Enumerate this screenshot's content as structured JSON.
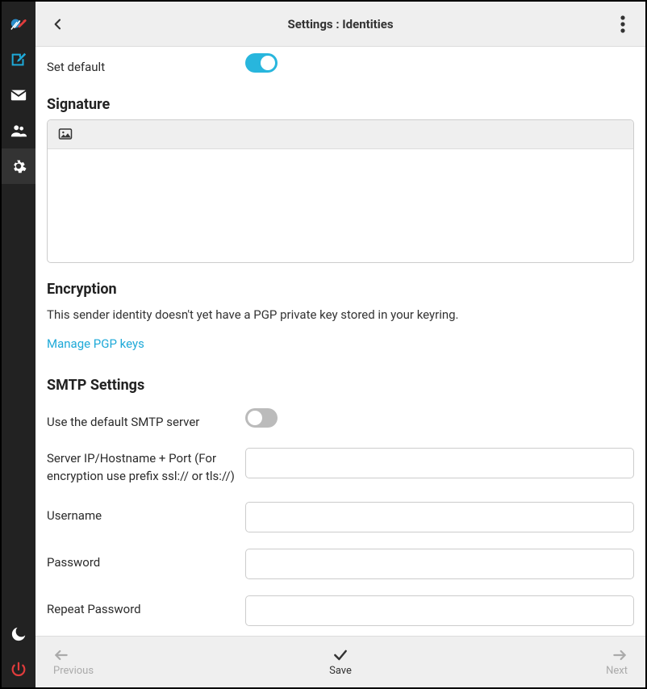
{
  "header": {
    "title": "Settings : Identities"
  },
  "set_default": {
    "label": "Set default",
    "on": true
  },
  "signature": {
    "title": "Signature"
  },
  "encryption": {
    "title": "Encryption",
    "message": "This sender identity doesn't yet have a PGP private key stored in your keyring.",
    "manage_link": "Manage PGP keys"
  },
  "smtp": {
    "title": "SMTP Settings",
    "use_default": {
      "label": "Use the default SMTP server",
      "on": false
    },
    "server": {
      "label": "Server IP/Hostname + Port (For encryption use prefix ssl:// or tls://)",
      "value": ""
    },
    "username": {
      "label": "Username",
      "value": ""
    },
    "password": {
      "label": "Password",
      "value": ""
    },
    "repeat_password": {
      "label": "Repeat Password",
      "value": ""
    }
  },
  "footer": {
    "previous": "Previous",
    "save": "Save",
    "next": "Next"
  }
}
